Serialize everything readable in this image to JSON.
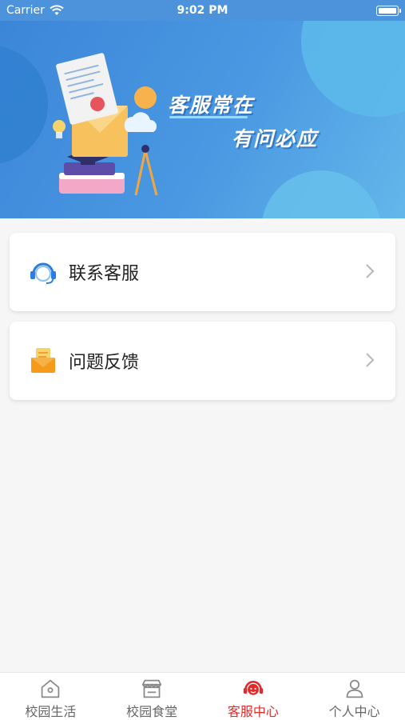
{
  "status_bar": {
    "carrier": "Carrier",
    "time": "9:02 PM"
  },
  "banner": {
    "slogan_line1": "客服常在",
    "slogan_line2": "有问必应"
  },
  "menu": [
    {
      "label": "联系客服",
      "icon": "headset-icon"
    },
    {
      "label": "问题反馈",
      "icon": "mail-icon"
    }
  ],
  "tabbar": {
    "active_color": "#e32a2a",
    "items": [
      {
        "label": "校园生活",
        "icon": "home-icon",
        "active": false
      },
      {
        "label": "校园食堂",
        "icon": "shop-icon",
        "active": false
      },
      {
        "label": "客服中心",
        "icon": "headset-icon",
        "active": true
      },
      {
        "label": "个人中心",
        "icon": "person-icon",
        "active": false
      }
    ]
  }
}
